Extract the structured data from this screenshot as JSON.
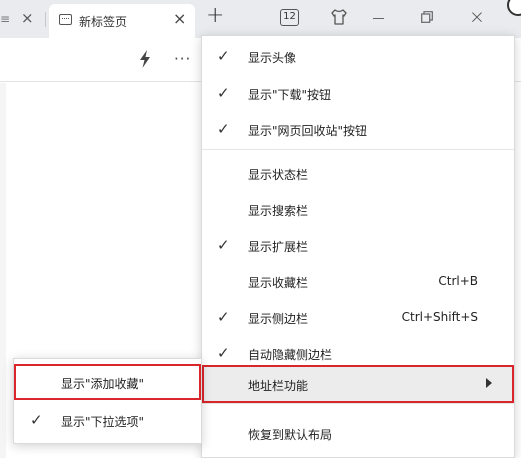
{
  "tabs": {
    "active_title": "新标签页",
    "close_glyph": "×",
    "new_tab_glyph": "+",
    "tab_count": "12"
  },
  "window": {
    "close_glyph": "×"
  },
  "toolbar": {
    "more_glyph": "···"
  },
  "main_menu": {
    "items": [
      {
        "label": "显示头像",
        "checked": true,
        "shortcut": ""
      },
      {
        "label": "显示\"下载\"按钮",
        "checked": true,
        "shortcut": ""
      },
      {
        "label": "显示\"网页回收站\"按钮",
        "checked": true,
        "shortcut": ""
      },
      {
        "label": "显示状态栏",
        "checked": false,
        "shortcut": ""
      },
      {
        "label": "显示搜索栏",
        "checked": false,
        "shortcut": ""
      },
      {
        "label": "显示扩展栏",
        "checked": true,
        "shortcut": ""
      },
      {
        "label": "显示收藏栏",
        "checked": false,
        "shortcut": "Ctrl+B"
      },
      {
        "label": "显示侧边栏",
        "checked": true,
        "shortcut": "Ctrl+Shift+S"
      },
      {
        "label": "自动隐藏侧边栏",
        "checked": true,
        "shortcut": ""
      },
      {
        "label": "地址栏功能",
        "checked": false,
        "shortcut": "",
        "submenu": true,
        "highlighted": true
      },
      {
        "label": "恢复到默认布局",
        "checked": false,
        "shortcut": ""
      }
    ],
    "check_glyph": "✓"
  },
  "sub_menu": {
    "items": [
      {
        "label": "显示\"添加收藏\"",
        "checked": false,
        "highlighted": true
      },
      {
        "label": "显示\"下拉选项\"",
        "checked": true
      }
    ]
  },
  "colors": {
    "highlight_outline": "#d9262b",
    "tabbar_bg": "#e9ebee",
    "hover_bg": "#ececec"
  }
}
